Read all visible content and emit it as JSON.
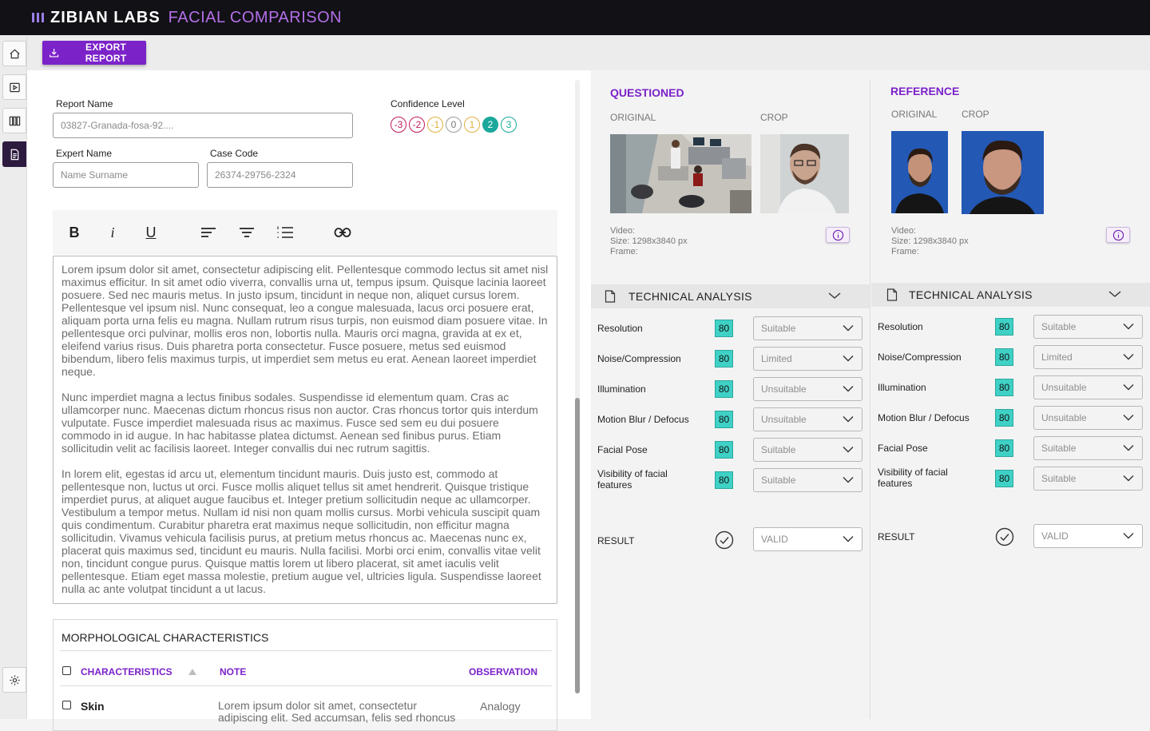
{
  "header": {
    "brand": "ZIBIAN LABS",
    "product": "FACIAL COMPARISON"
  },
  "sidebar": {
    "items": [
      {
        "icon": "home-icon"
      },
      {
        "icon": "play-icon"
      },
      {
        "icon": "compare-icon"
      },
      {
        "icon": "document-icon",
        "active": true
      }
    ],
    "settings_icon": "gear-icon"
  },
  "actions": {
    "export_label": "EXPORT REPORT"
  },
  "form": {
    "report_name_label": "Report Name",
    "report_name_value": "03827-Granada-fosa-92....",
    "expert_name_label": "Expert Name",
    "expert_name_placeholder": "Name Surname",
    "case_code_label": "Case Code",
    "case_code_value": "26374-29756-2324",
    "confidence_label": "Confidence Level",
    "confidence_levels": [
      {
        "label": "-3",
        "color": "#c2185b"
      },
      {
        "label": "-2",
        "color": "#c2185b"
      },
      {
        "label": "-1",
        "color": "#e0b040"
      },
      {
        "label": "0",
        "color": "#9a9a9a"
      },
      {
        "label": "1",
        "color": "#e0b040"
      },
      {
        "label": "2",
        "color": "#1aa89c",
        "selected": true
      },
      {
        "label": "3",
        "color": "#1aa89c"
      }
    ]
  },
  "editor": {
    "tools": [
      "bold",
      "italic",
      "underline",
      "align-left",
      "align-center",
      "ordered-list",
      "link"
    ],
    "paragraphs": [
      "Lorem ipsum dolor sit amet, consectetur adipiscing elit. Pellentesque commodo lectus sit amet nisl maximus efficitur. In sit amet odio viverra, convallis urna ut, tempus ipsum. Quisque lacinia laoreet posuere. Sed nec mauris metus. In justo ipsum, tincidunt in neque non, aliquet cursus lorem. Pellentesque vel ipsum nisl. Nunc consequat, leo a congue malesuada, lacus orci posuere erat, aliquam porta urna felis eu magna. Nullam rutrum risus turpis, non euismod diam posuere vitae. In pellentesque orci pulvinar, mollis eros non, lobortis nulla. Mauris orci magna, gravida at ex et, eleifend varius risus. Duis pharetra porta consectetur. Fusce posuere, metus sed euismod bibendum, libero felis maximus turpis, ut imperdiet sem metus eu erat. Aenean laoreet imperdiet neque.",
      "Nunc imperdiet magna a lectus finibus sodales. Suspendisse id elementum quam. Cras ac ullamcorper nunc. Maecenas dictum rhoncus risus non auctor. Cras rhoncus tortor quis interdum vulputate. Fusce imperdiet malesuada risus ac maximus. Fusce sed sem eu dui posuere commodo in id augue. In hac habitasse platea dictumst. Aenean sed finibus purus. Etiam sollicitudin velit ac facilisis laoreet. Integer convallis dui nec rutrum sagittis.",
      "In lorem elit, egestas id arcu ut, elementum tincidunt mauris. Duis justo est, commodo at pellentesque non, luctus ut orci. Fusce mollis aliquet tellus sit amet hendrerit. Quisque tristique imperdiet purus, at aliquet augue faucibus et. Integer pretium sollicitudin neque ac ullamcorper. Vestibulum a tempor metus. Nullam id nisi non quam mollis cursus. Morbi vehicula suscipit quam quis condimentum. Curabitur pharetra erat maximus neque sollicitudin, non efficitur magna sollicitudin. Vivamus vehicula facilisis purus, at pretium metus rhoncus ac. Maecenas nunc ex, placerat quis maximus sed, tincidunt eu mauris. Nulla facilisi. Morbi orci enim, convallis vitae velit non, tincidunt congue purus. Quisque mattis lorem ut libero placerat, sit amet iaculis velit pellentesque. Etiam eget massa molestie, pretium augue vel, ultricies ligula. Suspendisse laoreet nulla ac ante volutpat tincidunt a ut lacus."
    ]
  },
  "morphological": {
    "title": "MORPHOLOGICAL CHARACTERISTICS",
    "columns": [
      "CHARACTERISTICS",
      "NOTE",
      "OBSERVATION"
    ],
    "rows": [
      {
        "name": "Skin",
        "note": "Lorem ipsum dolor sit amet, consectetur adipiscing elit. Sed accumsan, felis sed rhoncus",
        "observation": "Analogy"
      }
    ]
  },
  "questioned": {
    "title": "QUESTIONED",
    "original_label": "ORIGINAL",
    "crop_label": "CROP",
    "meta": {
      "video": "Video:",
      "size": "Size: 1298x3840 px",
      "frame": "Frame:"
    }
  },
  "reference": {
    "title": "REFERENCE",
    "original_label": "ORIGINAL",
    "crop_label": "CROP",
    "meta": {
      "video": "Video:",
      "size": "Size: 1298x3840 px",
      "frame": "Frame:"
    }
  },
  "technical": {
    "title": "TECHNICAL ANALYSIS",
    "questioned_rows": [
      {
        "label": "Resolution",
        "score": "80",
        "value": "Suitable"
      },
      {
        "label": "Noise/Compression",
        "score": "80",
        "value": "Limited"
      },
      {
        "label": "Illumination",
        "score": "80",
        "value": "Unsuitable"
      },
      {
        "label": "Motion Blur / Defocus",
        "score": "80",
        "value": "Unsuitable"
      },
      {
        "label": "Facial Pose",
        "score": "80",
        "value": "Suitable"
      },
      {
        "label": "Visibility of facial features",
        "score": "80",
        "value": "Suitable"
      }
    ],
    "reference_rows": [
      {
        "label": "Resolution",
        "score": "80",
        "value": "Suitable"
      },
      {
        "label": "Noise/Compression",
        "score": "80",
        "value": "Limited"
      },
      {
        "label": "Illumination",
        "score": "80",
        "value": "Unsuitable"
      },
      {
        "label": "Motion Blur / Defocus",
        "score": "80",
        "value": "Unsuitable"
      },
      {
        "label": "Facial Pose",
        "score": "80",
        "value": "Suitable"
      },
      {
        "label": "Visibility of facial features",
        "score": "80",
        "value": "Suitable"
      }
    ],
    "result_label": "RESULT",
    "result_value": "VALID"
  }
}
